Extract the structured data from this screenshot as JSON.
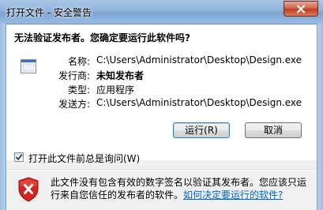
{
  "window": {
    "title": "打开文件 - 安全警告"
  },
  "dialog": {
    "heading": "无法验证发布者。您确定要运行此软件吗?",
    "fields": [
      {
        "label": "名称:",
        "value": "C:\\Users\\Administrator\\Desktop\\Design.exe",
        "bold": false
      },
      {
        "label": "发行商:",
        "value": "未知发布者",
        "bold": true
      },
      {
        "label": "类型:",
        "value": "应用程序",
        "bold": false
      },
      {
        "label": "发送方:",
        "value": "C:\\Users\\Administrator\\Desktop\\Design.exe",
        "bold": false
      }
    ],
    "run_button": "运行(R)",
    "cancel_button": "取消",
    "checkbox": {
      "label": "打开此文件前总是询问(W)",
      "checked": true
    },
    "warning": {
      "text": "此文件没有包含有效的数字签名以验证其发布者。您应该只运行来自您信任的发布者的软件。",
      "link": "如何决定要运行的软件?"
    }
  },
  "colors": {
    "link": "#0066cc",
    "shield_red": "#d6241c",
    "titlebar": "#8fb3dc"
  },
  "icons": [
    "close-icon",
    "application-file-icon",
    "checkmark-icon",
    "security-shield-icon"
  ]
}
